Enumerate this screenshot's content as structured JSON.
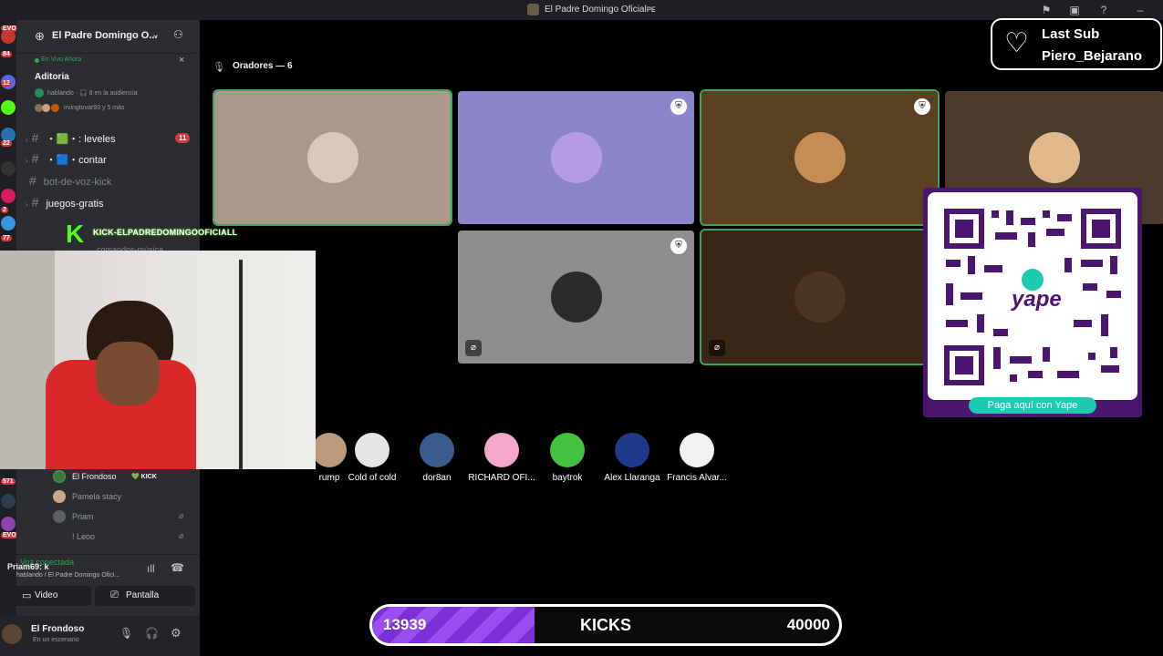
{
  "window": {
    "title": "El Padre Domingo Oficialᴘᴇ"
  },
  "rail": {
    "badges": [
      "EVO",
      "84",
      "12",
      "22",
      "2",
      "77",
      "571",
      "EVO"
    ]
  },
  "sidebar": {
    "server_name": "El Padre Domingo O...",
    "live": {
      "badge": "En Vivo Ahora",
      "title": "Aditoria",
      "status": "hablando · 🎧 8 en la audiencia",
      "people": "irvingtovar93 y 5 más"
    },
    "channels": [
      {
        "name": "・🟩・: leveles",
        "badge": "11"
      },
      {
        "name": "・🟦・contar",
        "badge": ""
      },
      {
        "name": "bot-de-voz-kick",
        "badge": ""
      },
      {
        "name": "juegos-gratis",
        "badge": ""
      },
      {
        "name": "comandos-música",
        "badge": ""
      }
    ],
    "kick_banner": "KICK-ELPADREDOMINGOOFICIALL",
    "members": [
      {
        "name": "El Frondoso",
        "tag": "💚 KICK"
      },
      {
        "name": "Pamela stacy",
        "tag": ""
      },
      {
        "name": "Priam",
        "tag": ""
      },
      {
        "name": "! Leoo",
        "tag": ""
      }
    ],
    "voice": {
      "status": "Voz conectada",
      "user_overlay": "Priam69: k",
      "channel": "hablando / El Padre Domingo Ofici..."
    },
    "buttons": {
      "video": "Video",
      "screen": "Pantalla"
    },
    "user": {
      "name": "El Frondoso",
      "status": "En un escenario"
    }
  },
  "stage": {
    "speakers_header": "Oradores — 6",
    "tiles": [
      {
        "bg": "#a8998a",
        "avatar": "#d9c8b8",
        "border": "#3ba55d"
      },
      {
        "bg": "#8b86c9",
        "avatar": "#b59be3",
        "border": ""
      },
      {
        "bg": "#5a3f23",
        "avatar": "#c58d54",
        "border": "#3ba55d"
      },
      {
        "bg": "#4a3b2c",
        "avatar": "#e0b88c",
        "border": ""
      },
      {
        "bg": "#8e8e8e",
        "avatar": "#2b2b2b",
        "border": ""
      },
      {
        "bg": "#3a2718",
        "avatar": "#4b3523",
        "border": "#3ba55d"
      }
    ],
    "audience": [
      {
        "name": "rump",
        "color": "#b99a7a"
      },
      {
        "name": "Cold of cold",
        "color": "#e6e6e6"
      },
      {
        "name": "dor8an",
        "color": "#3a5c8c"
      },
      {
        "name": "RICHARD OFI...",
        "color": "#f3a7c9"
      },
      {
        "name": "baytrok",
        "color": "#44c244"
      },
      {
        "name": "Alex Llaranga",
        "color": "#1f3a8a"
      },
      {
        "name": "Francis Alvar...",
        "color": "#f2f2f2"
      }
    ]
  },
  "overlays": {
    "last_sub": {
      "label": "Last Sub",
      "name": "Piero_Bejarano"
    },
    "qr": {
      "brand": "yape",
      "caption": "Paga aquí con Yape"
    },
    "kicks": {
      "current": "13939",
      "label": "KICKS",
      "goal": "40000",
      "progress": 0.348
    }
  },
  "colors": {
    "accent": "#3ba55d",
    "kick_purple": "#7b2fd6",
    "yape": "#4a1670",
    "yape_teal": "#1ec9b0"
  }
}
